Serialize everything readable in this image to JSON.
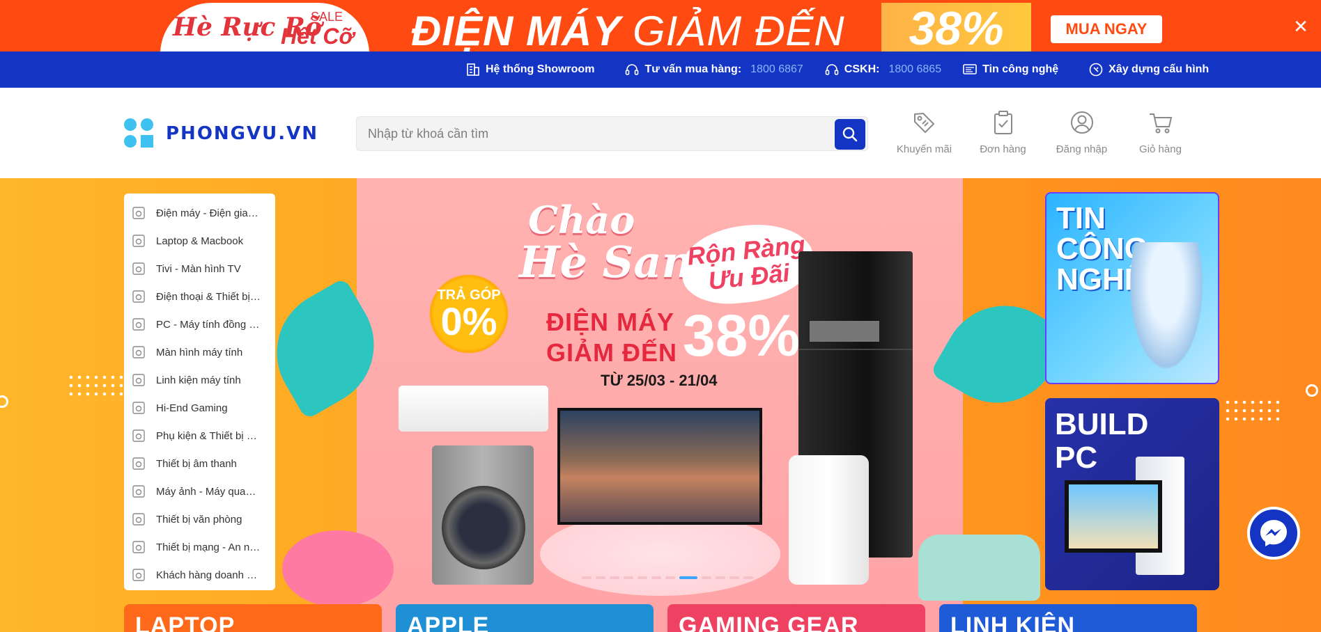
{
  "promo": {
    "brand_line1": "Hè Rực Rỡ",
    "brand_sale": "SALE",
    "brand_line2": "Hết Cỡ",
    "headline_bold": "ĐIỆN MÁY",
    "headline_thin": "GIẢM ĐẾN",
    "percent": "38%",
    "cta": "MUA NGAY",
    "close": "✕"
  },
  "util_bar": {
    "items": [
      {
        "label": "Hệ thống Showroom",
        "number": "",
        "icon": "building-icon"
      },
      {
        "label": "Tư vấn mua hàng:",
        "number": "1800 6867",
        "icon": "headset-icon"
      },
      {
        "label": "CSKH:",
        "number": "1800 6865",
        "icon": "headset-icon"
      },
      {
        "label": "Tin công nghệ",
        "number": "",
        "icon": "news-icon"
      },
      {
        "label": "Xây dựng cấu hình",
        "number": "",
        "icon": "build-icon"
      }
    ]
  },
  "header": {
    "logo_text": "PHONGVU.VN",
    "search_placeholder": "Nhập từ khoá cần tìm",
    "actions": [
      {
        "label": "Khuyến mãi",
        "icon": "tag-icon"
      },
      {
        "label": "Đơn hàng",
        "icon": "clipboard-icon"
      },
      {
        "label": "Đăng nhập",
        "icon": "user-icon"
      },
      {
        "label": "Giỏ hàng",
        "icon": "cart-icon"
      }
    ]
  },
  "categories": [
    {
      "label": "Điện máy - Điện gia dụng",
      "icon": "washer-icon"
    },
    {
      "label": "Laptop & Macbook",
      "icon": "laptop-icon"
    },
    {
      "label": "Tivi - Màn hình TV",
      "icon": "tv-icon"
    },
    {
      "label": "Điện thoại & Thiết bị thông minh",
      "icon": "phone-icon"
    },
    {
      "label": "PC - Máy tính đồng bộ",
      "icon": "pc-icon"
    },
    {
      "label": "Màn hình máy tính",
      "icon": "monitor-icon"
    },
    {
      "label": "Linh kiện máy tính",
      "icon": "chip-icon"
    },
    {
      "label": "Hi-End Gaming",
      "icon": "gaming-icon"
    },
    {
      "label": "Phụ kiện & Thiết bị ngoại vi",
      "icon": "webcam-icon"
    },
    {
      "label": "Thiết bị âm thanh",
      "icon": "speaker-icon"
    },
    {
      "label": "Máy ảnh - Máy quay phim",
      "icon": "camera-icon"
    },
    {
      "label": "Thiết bị văn phòng",
      "icon": "printer-icon"
    },
    {
      "label": "Thiết bị mạng - An ninh",
      "icon": "antenna-icon"
    },
    {
      "label": "Khách hàng doanh nghiệp",
      "icon": "chart-icon"
    }
  ],
  "hero": {
    "title1": "Chào",
    "title2": "Hè Sang",
    "badge_line1": "Rộn Ràng",
    "badge_line2": "Ưu Đãi",
    "sun_line1": "TRẢ GÓP",
    "sun_big": "0%",
    "deal_line1": "ĐIỆN MÁY",
    "deal_line2": "GIẢM ĐẾN",
    "deal_percent": "38%",
    "deal_date": "TỪ 25/03 - 21/04",
    "pager_count": 12,
    "pager_active": 7
  },
  "side_promos": {
    "tech": "TIN\nCÔNG\nNGHỆ",
    "pc": "BUILD\nPC"
  },
  "bottom_cards": [
    "LAPTOP",
    "APPLE",
    "GAMING GEAR",
    "LINH KIỆN"
  ],
  "colors": {
    "brand_blue": "#1435c3",
    "promo_orange": "#ff4a12",
    "accent_light_blue": "#89b8ff"
  }
}
